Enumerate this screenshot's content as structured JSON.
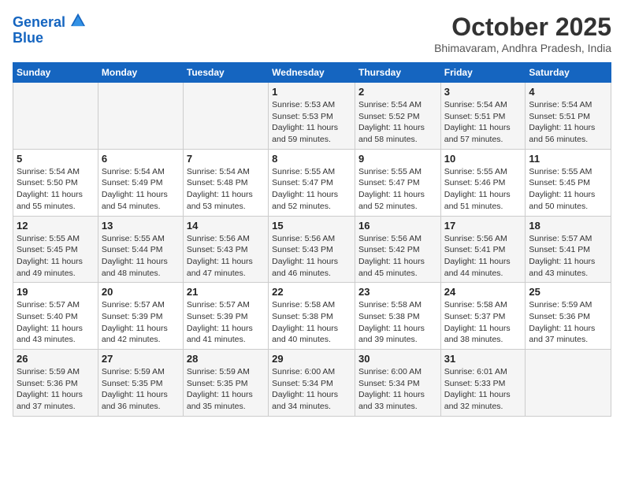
{
  "header": {
    "logo_line1": "General",
    "logo_line2": "Blue",
    "month": "October 2025",
    "location": "Bhimavaram, Andhra Pradesh, India"
  },
  "weekdays": [
    "Sunday",
    "Monday",
    "Tuesday",
    "Wednesday",
    "Thursday",
    "Friday",
    "Saturday"
  ],
  "weeks": [
    [
      {
        "day": "",
        "info": ""
      },
      {
        "day": "",
        "info": ""
      },
      {
        "day": "",
        "info": ""
      },
      {
        "day": "1",
        "info": "Sunrise: 5:53 AM\nSunset: 5:53 PM\nDaylight: 11 hours\nand 59 minutes."
      },
      {
        "day": "2",
        "info": "Sunrise: 5:54 AM\nSunset: 5:52 PM\nDaylight: 11 hours\nand 58 minutes."
      },
      {
        "day": "3",
        "info": "Sunrise: 5:54 AM\nSunset: 5:51 PM\nDaylight: 11 hours\nand 57 minutes."
      },
      {
        "day": "4",
        "info": "Sunrise: 5:54 AM\nSunset: 5:51 PM\nDaylight: 11 hours\nand 56 minutes."
      }
    ],
    [
      {
        "day": "5",
        "info": "Sunrise: 5:54 AM\nSunset: 5:50 PM\nDaylight: 11 hours\nand 55 minutes."
      },
      {
        "day": "6",
        "info": "Sunrise: 5:54 AM\nSunset: 5:49 PM\nDaylight: 11 hours\nand 54 minutes."
      },
      {
        "day": "7",
        "info": "Sunrise: 5:54 AM\nSunset: 5:48 PM\nDaylight: 11 hours\nand 53 minutes."
      },
      {
        "day": "8",
        "info": "Sunrise: 5:55 AM\nSunset: 5:47 PM\nDaylight: 11 hours\nand 52 minutes."
      },
      {
        "day": "9",
        "info": "Sunrise: 5:55 AM\nSunset: 5:47 PM\nDaylight: 11 hours\nand 52 minutes."
      },
      {
        "day": "10",
        "info": "Sunrise: 5:55 AM\nSunset: 5:46 PM\nDaylight: 11 hours\nand 51 minutes."
      },
      {
        "day": "11",
        "info": "Sunrise: 5:55 AM\nSunset: 5:45 PM\nDaylight: 11 hours\nand 50 minutes."
      }
    ],
    [
      {
        "day": "12",
        "info": "Sunrise: 5:55 AM\nSunset: 5:45 PM\nDaylight: 11 hours\nand 49 minutes."
      },
      {
        "day": "13",
        "info": "Sunrise: 5:55 AM\nSunset: 5:44 PM\nDaylight: 11 hours\nand 48 minutes."
      },
      {
        "day": "14",
        "info": "Sunrise: 5:56 AM\nSunset: 5:43 PM\nDaylight: 11 hours\nand 47 minutes."
      },
      {
        "day": "15",
        "info": "Sunrise: 5:56 AM\nSunset: 5:43 PM\nDaylight: 11 hours\nand 46 minutes."
      },
      {
        "day": "16",
        "info": "Sunrise: 5:56 AM\nSunset: 5:42 PM\nDaylight: 11 hours\nand 45 minutes."
      },
      {
        "day": "17",
        "info": "Sunrise: 5:56 AM\nSunset: 5:41 PM\nDaylight: 11 hours\nand 44 minutes."
      },
      {
        "day": "18",
        "info": "Sunrise: 5:57 AM\nSunset: 5:41 PM\nDaylight: 11 hours\nand 43 minutes."
      }
    ],
    [
      {
        "day": "19",
        "info": "Sunrise: 5:57 AM\nSunset: 5:40 PM\nDaylight: 11 hours\nand 43 minutes."
      },
      {
        "day": "20",
        "info": "Sunrise: 5:57 AM\nSunset: 5:39 PM\nDaylight: 11 hours\nand 42 minutes."
      },
      {
        "day": "21",
        "info": "Sunrise: 5:57 AM\nSunset: 5:39 PM\nDaylight: 11 hours\nand 41 minutes."
      },
      {
        "day": "22",
        "info": "Sunrise: 5:58 AM\nSunset: 5:38 PM\nDaylight: 11 hours\nand 40 minutes."
      },
      {
        "day": "23",
        "info": "Sunrise: 5:58 AM\nSunset: 5:38 PM\nDaylight: 11 hours\nand 39 minutes."
      },
      {
        "day": "24",
        "info": "Sunrise: 5:58 AM\nSunset: 5:37 PM\nDaylight: 11 hours\nand 38 minutes."
      },
      {
        "day": "25",
        "info": "Sunrise: 5:59 AM\nSunset: 5:36 PM\nDaylight: 11 hours\nand 37 minutes."
      }
    ],
    [
      {
        "day": "26",
        "info": "Sunrise: 5:59 AM\nSunset: 5:36 PM\nDaylight: 11 hours\nand 37 minutes."
      },
      {
        "day": "27",
        "info": "Sunrise: 5:59 AM\nSunset: 5:35 PM\nDaylight: 11 hours\nand 36 minutes."
      },
      {
        "day": "28",
        "info": "Sunrise: 5:59 AM\nSunset: 5:35 PM\nDaylight: 11 hours\nand 35 minutes."
      },
      {
        "day": "29",
        "info": "Sunrise: 6:00 AM\nSunset: 5:34 PM\nDaylight: 11 hours\nand 34 minutes."
      },
      {
        "day": "30",
        "info": "Sunrise: 6:00 AM\nSunset: 5:34 PM\nDaylight: 11 hours\nand 33 minutes."
      },
      {
        "day": "31",
        "info": "Sunrise: 6:01 AM\nSunset: 5:33 PM\nDaylight: 11 hours\nand 32 minutes."
      },
      {
        "day": "",
        "info": ""
      }
    ]
  ]
}
